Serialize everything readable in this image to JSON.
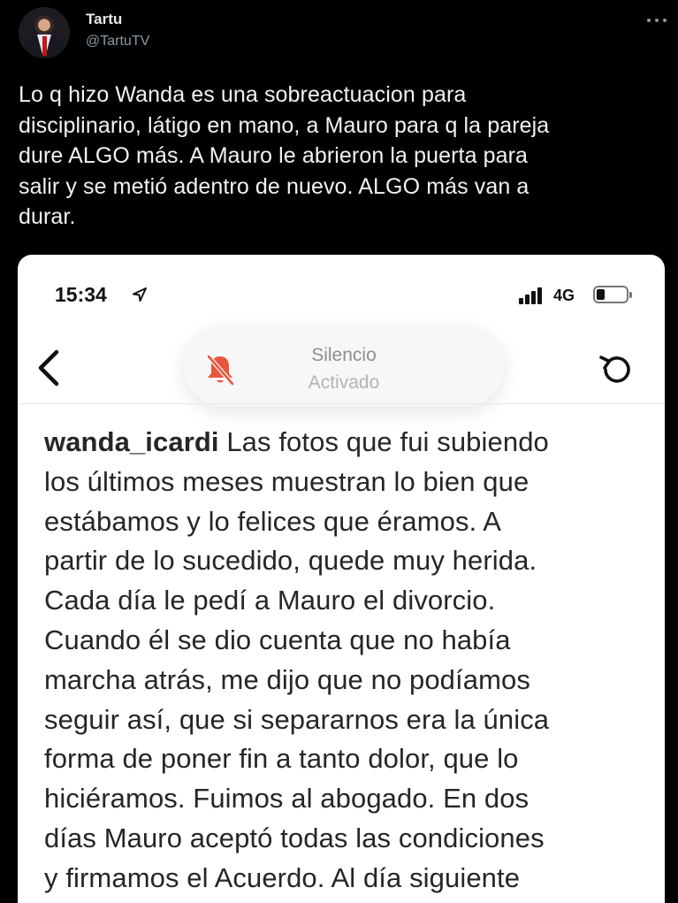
{
  "tweet": {
    "author_name": "Tartu",
    "author_handle": "@TartuTV",
    "lines": [
      "Lo q hizo Wanda es una sobreactuacion para",
      "disciplinario, látigo en mano, a Mauro para q la pareja",
      "dure ALGO más. A Mauro le abrieron la puerta para",
      "salir y se metió adentro de nuevo. ALGO más van a",
      "durar."
    ],
    "more_icon": "more-horizontal-icon"
  },
  "screenshot": {
    "status_bar": {
      "time": "15:34",
      "network": "4G",
      "icons": [
        "location-arrow-icon",
        "signal-bars-icon",
        "battery-icon"
      ]
    },
    "nav": {
      "back_icon": "chevron-left-icon",
      "refresh_icon": "refresh-icon"
    },
    "silence_banner": {
      "title": "Silencio",
      "subtitle": "Activado",
      "icon": "bell-slash-icon",
      "icon_color": "#e8553e"
    },
    "caption": {
      "username": "wanda_icardi",
      "first_line_rest": " Las fotos que fui subiendo",
      "lines": [
        "los últimos meses muestran lo bien que",
        "estábamos y lo felices que éramos. A",
        "partir de lo sucedido, quede muy herida.",
        "Cada día le pedí a Mauro el divorcio.",
        "Cuando él se dio cuenta que no había",
        "marcha atrás, me dijo que no podíamos",
        "seguir así, que si separarnos era la única",
        "forma de poner fin a tanto dolor, que lo",
        "hiciéramos. Fuimos al abogado. En dos",
        "días Mauro aceptó todas las condiciones",
        "y firmamos el Acuerdo. Al día siguiente"
      ]
    }
  },
  "colors": {
    "background": "#000000",
    "text_primary": "#e7e9ea",
    "text_secondary": "#8b98a5",
    "card_background": "#ffffff"
  }
}
